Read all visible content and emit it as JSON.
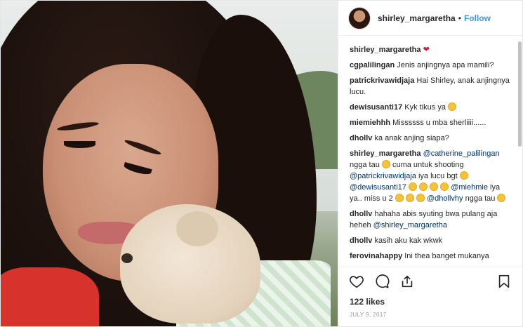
{
  "post": {
    "username": "shirley_margaretha",
    "separator": "•",
    "follow_label": "Follow",
    "likes": "122 likes",
    "date": "JULY 9, 2017",
    "caption": {
      "user": "shirley_margaretha",
      "text": "❤"
    }
  },
  "comments": [
    {
      "user": "cgpalilingan",
      "text": "Jenis anjingnya apa mamili?"
    },
    {
      "user": "patrickrivawidjaja",
      "text": "Hai Shirley, anak anjingnya lucu."
    },
    {
      "user": "dewisusanti17",
      "text": "Kyk tikus ya"
    },
    {
      "user": "miemiehhh",
      "text": "Missssss u mba sherliiii......"
    },
    {
      "user": "dhollv",
      "text": "ka anak anjing siapa?"
    },
    {
      "user": "shirley_margaretha",
      "m1": "@catherine_palilingan",
      "t1": "ngga tau",
      "t2": "cuma untuk shooting",
      "m2": "@patrickrivawidjaja",
      "t3": "iya lucu bgt",
      "m3": "@dewisusanti17",
      "m4": "@miehmie",
      "t4": "iya ya.. miss u 2",
      "m5": "@dhollvhy",
      "t5": "ngga tau"
    },
    {
      "user": "dhollv",
      "text": "hahaha abis syuting bwa pulang aja heheh",
      "mention": "@shirley_margaretha"
    },
    {
      "user": "dhollv",
      "text": "kasih aku kak wkwk"
    },
    {
      "user": "ferovinahappy",
      "text": "Ini thea banget mukanya"
    }
  ],
  "colors": {
    "link": "#3897f0",
    "mention": "#003569",
    "text": "#262626",
    "muted": "#999999"
  },
  "icons": [
    "heart-icon",
    "comment-icon",
    "share-icon",
    "bookmark-icon"
  ]
}
